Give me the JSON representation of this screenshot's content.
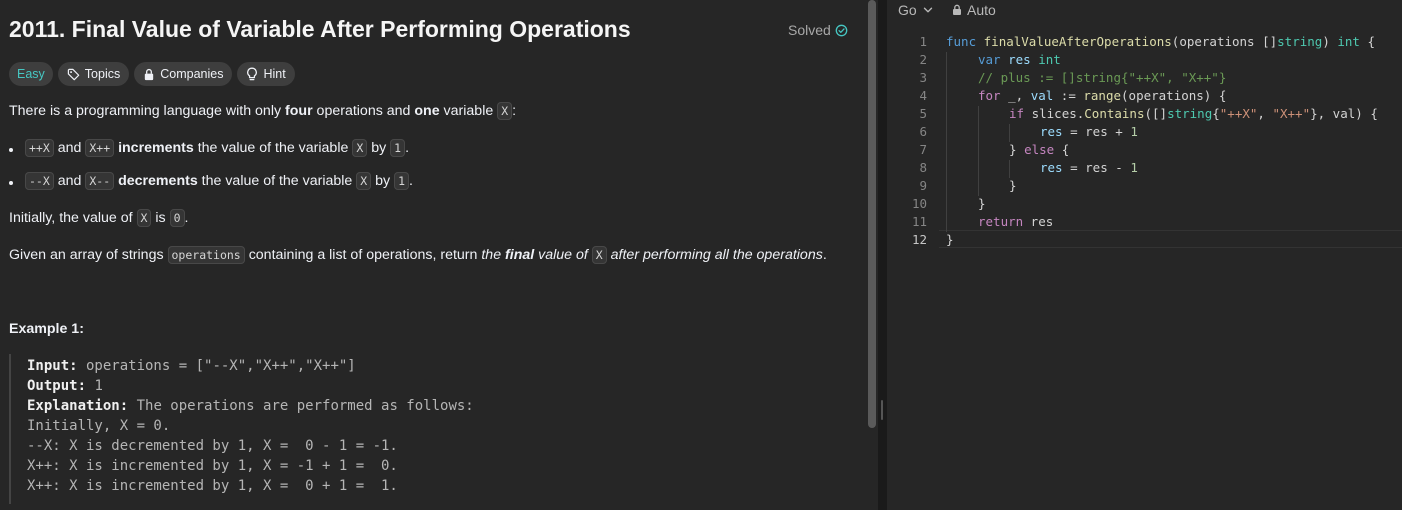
{
  "problem": {
    "title": "2011. Final Value of Variable After Performing Operations",
    "status": "Solved",
    "tags": {
      "difficulty": "Easy",
      "topics": "Topics",
      "companies": "Companies",
      "hint": "Hint"
    },
    "description": {
      "p1": {
        "a": "There is a programming language with only ",
        "b": "four",
        "c": " operations and ",
        "d": "one",
        "e": " variable ",
        "f": "X",
        "g": ":"
      },
      "b1": {
        "c1": "++X",
        "a": " and ",
        "c2": "X++",
        "b": " ",
        "bold": "increments",
        "c": " the value of the variable ",
        "c3": "X",
        "d": " by ",
        "c4": "1",
        "e": "."
      },
      "b2": {
        "c1": "--X",
        "a": " and ",
        "c2": "X--",
        "b": " ",
        "bold": "decrements",
        "c": " the value of the variable ",
        "c3": "X",
        "d": " by ",
        "c4": "1",
        "e": "."
      },
      "p2": {
        "a": "Initially, the value of ",
        "c1": "X",
        "b": " is ",
        "c2": "0",
        "c": "."
      },
      "p3": {
        "a": "Given an array of strings ",
        "c1": "operations",
        "b": " containing a list of operations, return ",
        "i1": "the ",
        "bi": "final",
        "i2": " value of ",
        "c2": "X",
        "i3": " after performing all the operations",
        "c": "."
      }
    },
    "example1": {
      "title": "Example 1:",
      "input_label": "Input:",
      "input": " operations = [\"--X\",\"X++\",\"X++\"]",
      "output_label": "Output:",
      "output": " 1",
      "explanation_label": "Explanation:",
      "explanation": " The operations are performed as follows:",
      "lines": [
        "Initially, X = 0.",
        "--X: X is decremented by 1, X =  0 - 1 = -1.",
        "X++: X is incremented by 1, X = -1 + 1 =  0.",
        "X++: X is incremented by 1, X =  0 + 1 =  1."
      ]
    }
  },
  "editor": {
    "language": "Go",
    "mode": "Auto",
    "line_numbers": [
      "1",
      "2",
      "3",
      "4",
      "5",
      "6",
      "7",
      "8",
      "9",
      "10",
      "11",
      "12"
    ],
    "code": {
      "l1": {
        "kw": "func",
        "fn": "finalValueAfterOperations",
        "p1": "(operations []",
        "ty": "string",
        "p2": ") ",
        "ty2": "int",
        "p3": " {"
      },
      "l2": {
        "kw": "var",
        "va": "res",
        "ty": "int"
      },
      "l3": "// plus := []string{\"++X\", \"X++\"}",
      "l4": {
        "kw": "for",
        "p1": " _, ",
        "va": "val",
        "p2": " := ",
        "fn": "range",
        "p3": "(operations) {"
      },
      "l5": {
        "kw": "if",
        "p1": " slices.",
        "fn": "Contains",
        "p2": "([]",
        "ty": "string",
        "p3": "{",
        "s1": "\"++X\"",
        "p4": ", ",
        "s2": "\"X++\"",
        "p5": "}, val) {"
      },
      "l6": {
        "va": "res",
        "p1": " = res + ",
        "nu": "1"
      },
      "l7": {
        "p1": "} ",
        "kw": "else",
        "p2": " {"
      },
      "l8": {
        "va": "res",
        "p1": " = res - ",
        "nu": "1"
      },
      "l9": "}",
      "l10": "}",
      "l11": {
        "kw": "return",
        "p1": " res"
      },
      "l12": "}"
    }
  }
}
